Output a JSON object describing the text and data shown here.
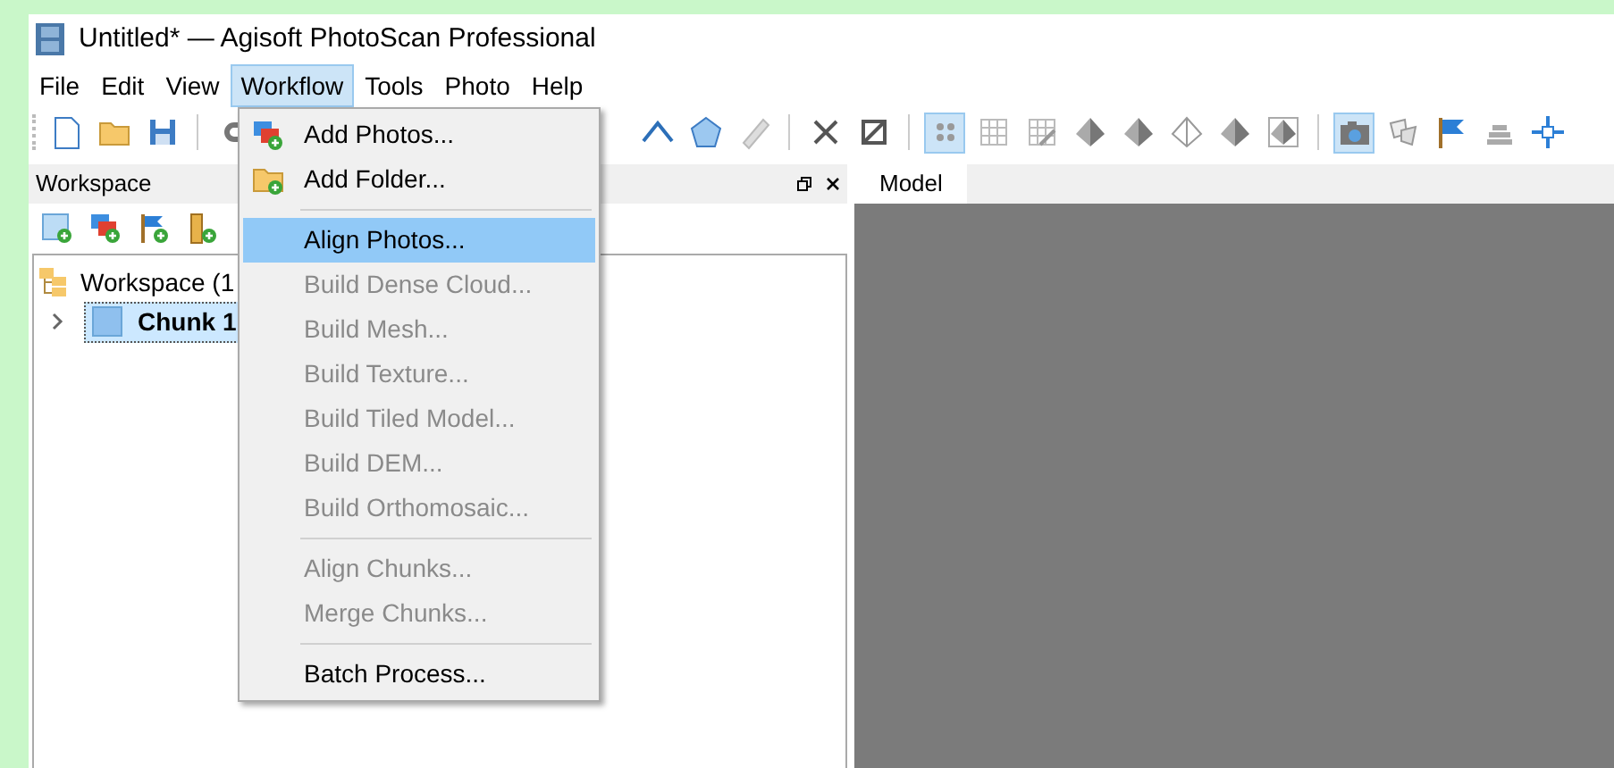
{
  "window": {
    "title": "Untitled* — Agisoft PhotoScan Professional"
  },
  "menu_bar": [
    {
      "label": "File",
      "selected": false
    },
    {
      "label": "Edit",
      "selected": false
    },
    {
      "label": "View",
      "selected": false
    },
    {
      "label": "Workflow",
      "selected": true
    },
    {
      "label": "Tools",
      "selected": false
    },
    {
      "label": "Photo",
      "selected": false
    },
    {
      "label": "Help",
      "selected": false
    }
  ],
  "toolbar_left": [
    {
      "kind": "new"
    },
    {
      "kind": "open"
    },
    {
      "kind": "save"
    },
    {
      "kind": "separator"
    },
    {
      "kind": "undo"
    }
  ],
  "toolbar_right": [
    {
      "kind": "angle",
      "selected": false
    },
    {
      "kind": "pentagon",
      "selected": false
    },
    {
      "kind": "ruler",
      "selected": false
    },
    {
      "kind": "separator"
    },
    {
      "kind": "cross",
      "selected": false
    },
    {
      "kind": "crop",
      "selected": false
    },
    {
      "kind": "separator"
    },
    {
      "kind": "points",
      "selected": true
    },
    {
      "kind": "grid",
      "selected": false
    },
    {
      "kind": "gridedit",
      "selected": false
    },
    {
      "kind": "pyramid",
      "selected": false
    },
    {
      "kind": "pyramid",
      "selected": false
    },
    {
      "kind": "pyramidoutline",
      "selected": false
    },
    {
      "kind": "pyramid",
      "selected": false
    },
    {
      "kind": "pyramidbox",
      "selected": false
    },
    {
      "kind": "separator"
    },
    {
      "kind": "camera",
      "selected": true
    },
    {
      "kind": "shapes",
      "selected": false
    },
    {
      "kind": "flag",
      "selected": false
    },
    {
      "kind": "layers",
      "selected": false
    },
    {
      "kind": "move",
      "selected": false
    }
  ],
  "workspace_panel": {
    "title": "Workspace",
    "toolbar": [
      {
        "kind": "chunkadd"
      },
      {
        "kind": "photosadd"
      },
      {
        "kind": "flagadd"
      },
      {
        "kind": "ruleradd"
      }
    ],
    "tree": [
      {
        "label": "Workspace (1",
        "kind": "workspace",
        "bold": false,
        "selected": false,
        "children": [
          {
            "label": "Chunk 1",
            "kind": "chunk",
            "bold": true,
            "selected": true,
            "expanded": false
          }
        ]
      }
    ]
  },
  "view_tabs": [
    {
      "label": "Model",
      "selected": true
    }
  ],
  "workflow_menu": [
    {
      "kind": "item",
      "label": "Add Photos...",
      "disabled": false,
      "selected": false
    },
    {
      "kind": "item",
      "label": "Add Folder...",
      "disabled": false,
      "selected": false
    },
    {
      "kind": "separator"
    },
    {
      "kind": "item",
      "label": "Align Photos...",
      "disabled": false,
      "selected": true
    },
    {
      "kind": "item",
      "label": "Build Dense Cloud...",
      "disabled": true,
      "selected": false
    },
    {
      "kind": "item",
      "label": "Build Mesh...",
      "disabled": true,
      "selected": false
    },
    {
      "kind": "item",
      "label": "Build Texture...",
      "disabled": true,
      "selected": false
    },
    {
      "kind": "item",
      "label": "Build Tiled Model...",
      "disabled": true,
      "selected": false
    },
    {
      "kind": "item",
      "label": "Build DEM...",
      "disabled": true,
      "selected": false
    },
    {
      "kind": "item",
      "label": "Build Orthomosaic...",
      "disabled": true,
      "selected": false
    },
    {
      "kind": "separator"
    },
    {
      "kind": "item",
      "label": "Align Chunks...",
      "disabled": true,
      "selected": false
    },
    {
      "kind": "item",
      "label": "Merge Chunks...",
      "disabled": true,
      "selected": false
    },
    {
      "kind": "separator"
    },
    {
      "kind": "item",
      "label": "Batch Process...",
      "disabled": false,
      "selected": false
    }
  ]
}
